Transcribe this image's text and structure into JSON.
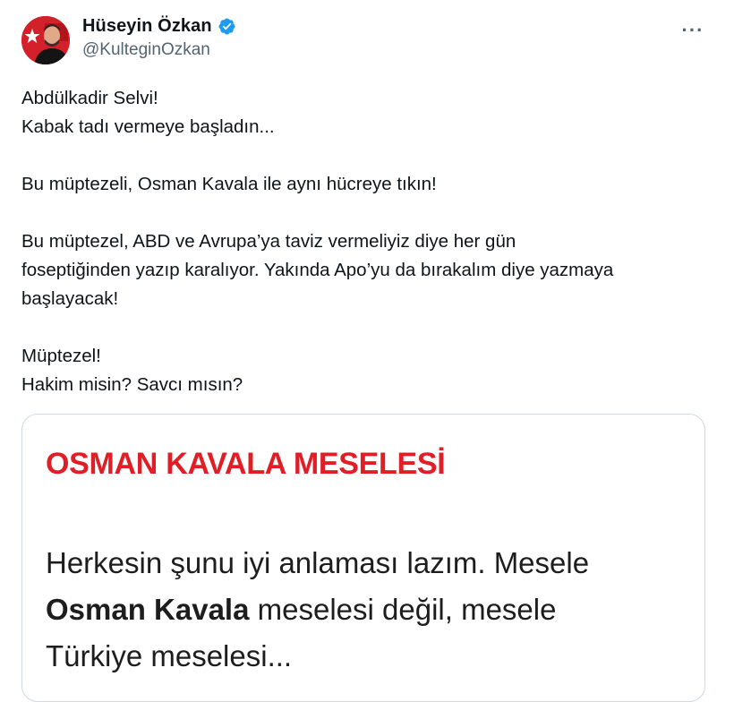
{
  "author": {
    "display_name": "Hüseyin Özkan",
    "handle": "@KulteginOzkan",
    "verified": true,
    "verified_color": "#1d9bf0",
    "avatar_icon": "avatar-photo"
  },
  "more_button": {
    "label": "···",
    "icon": "more-horizontal-icon"
  },
  "tweet": {
    "lines": [
      "Abdülkadir Selvi!",
      "Kabak tadı vermeye başladın...",
      "",
      "Bu müptezeli, Osman Kavala ile aynı hücreye tıkın!",
      "",
      "Bu müptezel, ABD ve Avrupa’ya taviz vermeliyiz diye her gün",
      "foseptiğinden yazıp karalıyor. Yakında Apo’yu da bırakalım diye yazmaya",
      "başlayacak!",
      "",
      "Müptezel!",
      "Hakim misin? Savcı mısın?"
    ]
  },
  "card": {
    "title": "OSMAN KAVALA MESELESİ",
    "title_color": "#e01e26",
    "body": {
      "line1": "Herkesin şunu iyi anlaması lazım. Mesele",
      "line2_bold": "Osman Kavala",
      "line2_rest": " meselesi değil, mesele",
      "line3": "Türkiye meselesi..."
    }
  }
}
